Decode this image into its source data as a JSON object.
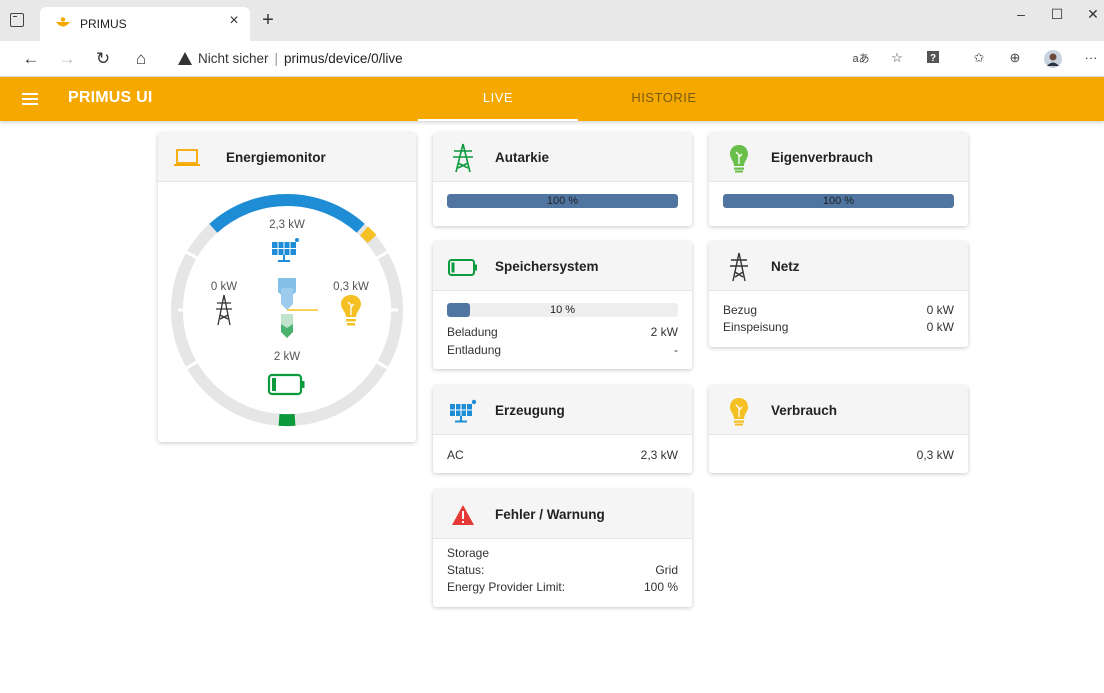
{
  "browser": {
    "tab_title": "PRIMUS",
    "security": "Nicht sicher",
    "url": "primus/device/0/live",
    "read_aloud": "aあ"
  },
  "app": {
    "title": "PRIMUS UI",
    "tabs": [
      {
        "label": "LIVE",
        "active": true
      },
      {
        "label": "HISTORIE",
        "active": false
      }
    ],
    "brand_color": "#f5a800"
  },
  "energiemonitor": {
    "title": "Energiemonitor",
    "pv_value": "2,3 kW",
    "grid_value": "0 kW",
    "consumption_value": "0,3 kW",
    "battery_value": "2 kW",
    "colors": {
      "pv": "#1f8dd6",
      "consumption": "#f5c023",
      "battery": "#0c9a3c",
      "track": "#e6e6e6"
    }
  },
  "autarkie": {
    "title": "Autarkie",
    "percent": 100,
    "label": "100 %"
  },
  "eigenverbrauch": {
    "title": "Eigenverbrauch",
    "percent": 100,
    "label": "100 %"
  },
  "speicher": {
    "title": "Speichersystem",
    "percent": 10,
    "label": "10 %",
    "rows": [
      {
        "key": "Beladung",
        "value": "2 kW"
      },
      {
        "key": "Entladung",
        "value": "-"
      }
    ]
  },
  "netz": {
    "title": "Netz",
    "rows": [
      {
        "key": "Bezug",
        "value": "0 kW"
      },
      {
        "key": "Einspeisung",
        "value": "0 kW"
      }
    ]
  },
  "erzeugung": {
    "title": "Erzeugung",
    "rows": [
      {
        "key": "AC",
        "value": "2,3 kW"
      }
    ]
  },
  "verbrauch": {
    "title": "Verbrauch",
    "value": "0,3 kW"
  },
  "fehler": {
    "title": "Fehler / Warnung",
    "storage_label": "Storage",
    "rows": [
      {
        "key": "Status:",
        "value": "Grid"
      },
      {
        "key": "Energy Provider Limit:",
        "value": "100 %"
      }
    ]
  }
}
